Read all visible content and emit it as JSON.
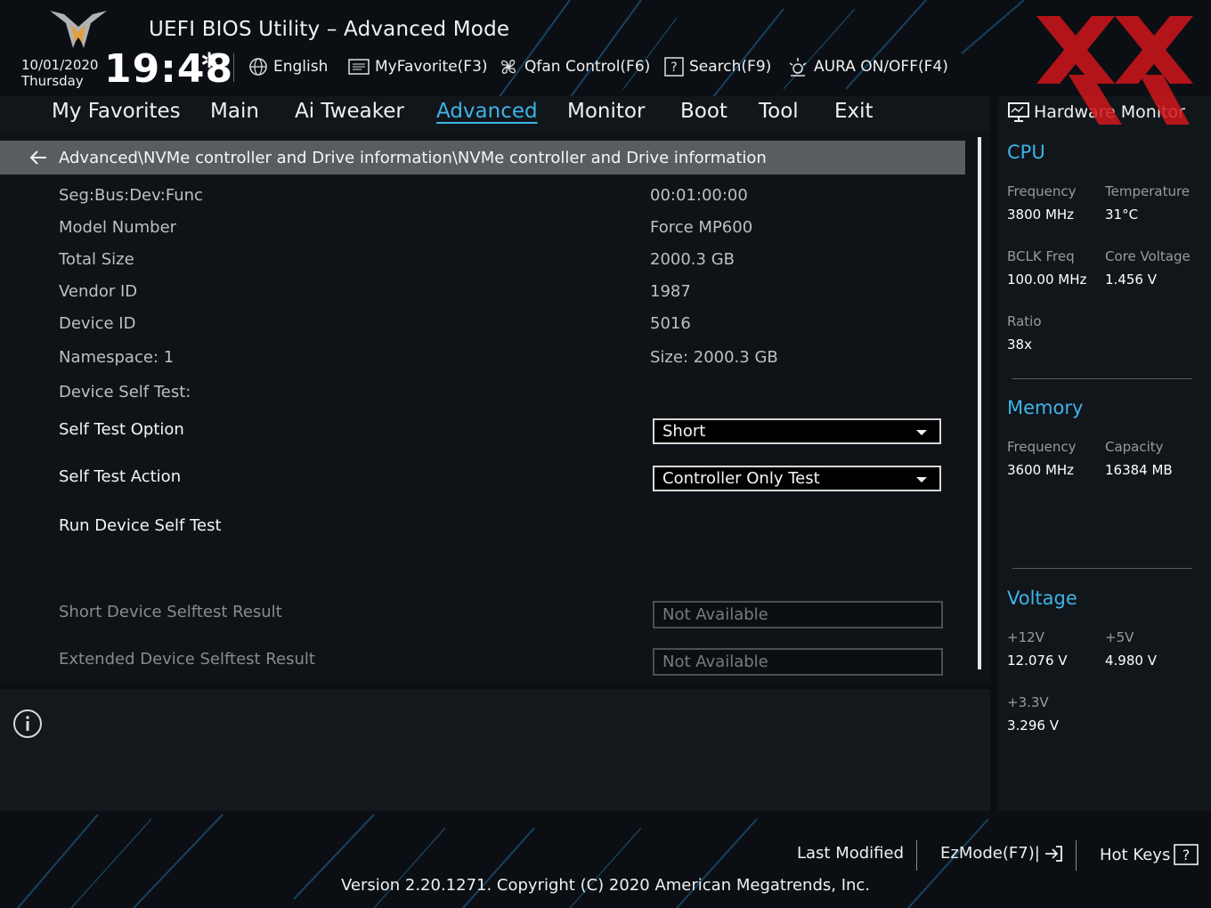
{
  "header": {
    "title": "UEFI BIOS Utility – Advanced Mode",
    "date": "10/01/2020",
    "weekday": "Thursday",
    "time": "19:48",
    "toolbar": {
      "language": "English",
      "favorite": "MyFavorite(F3)",
      "qfan": "Qfan Control(F6)",
      "search": "Search(F9)",
      "aura": "AURA ON/OFF(F4)"
    }
  },
  "nav": {
    "tabs": [
      "My Favorites",
      "Main",
      "Ai Tweaker",
      "Advanced",
      "Monitor",
      "Boot",
      "Tool",
      "Exit"
    ],
    "active": "Advanced"
  },
  "main": {
    "breadcrumb": "Advanced\\NVMe controller and Drive information\\NVMe controller and Drive information",
    "info": [
      {
        "label": "Seg:Bus:Dev:Func",
        "value": "00:01:00:00"
      },
      {
        "label": "Model Number",
        "value": "Force MP600"
      },
      {
        "label": "Total Size",
        "value": "2000.3 GB"
      },
      {
        "label": "Vendor ID",
        "value": "1987"
      },
      {
        "label": "Device ID",
        "value": "5016"
      },
      {
        "label": "Namespace: 1",
        "value": "Size: 2000.3 GB"
      }
    ],
    "self_test_heading": "Device Self Test:",
    "self_test_option": {
      "label": "Self Test Option",
      "value": "Short"
    },
    "self_test_action": {
      "label": "Self Test Action",
      "value": "Controller Only Test"
    },
    "run_test": "Run Device Self Test",
    "short_result": {
      "label": "Short Device Selftest Result",
      "value": "Not Available"
    },
    "extended_result": {
      "label": "Extended Device Selftest Result",
      "value": "Not Available"
    }
  },
  "hw_monitor": {
    "title": "Hardware Monitor",
    "cpu": {
      "heading": "CPU",
      "frequency_label": "Frequency",
      "frequency": "3800 MHz",
      "temperature_label": "Temperature",
      "temperature": "31°C",
      "bclk_label": "BCLK Freq",
      "bclk": "100.00 MHz",
      "core_voltage_label": "Core Voltage",
      "core_voltage": "1.456 V",
      "ratio_label": "Ratio",
      "ratio": "38x"
    },
    "memory": {
      "heading": "Memory",
      "frequency_label": "Frequency",
      "frequency": "3600 MHz",
      "capacity_label": "Capacity",
      "capacity": "16384 MB"
    },
    "voltage": {
      "heading": "Voltage",
      "v12_label": "+12V",
      "v12": "12.076 V",
      "v5_label": "+5V",
      "v5": "4.980 V",
      "v33_label": "+3.3V",
      "v33": "3.296 V"
    }
  },
  "footer": {
    "last_modified": "Last Modified",
    "ezmode": "EzMode(F7)|",
    "hotkeys": "Hot Keys",
    "version": "Version 2.20.1271. Copyright (C) 2020 American Megatrends, Inc."
  },
  "colors": {
    "accent": "#3fb3e6",
    "watermark": "#d0161b"
  }
}
